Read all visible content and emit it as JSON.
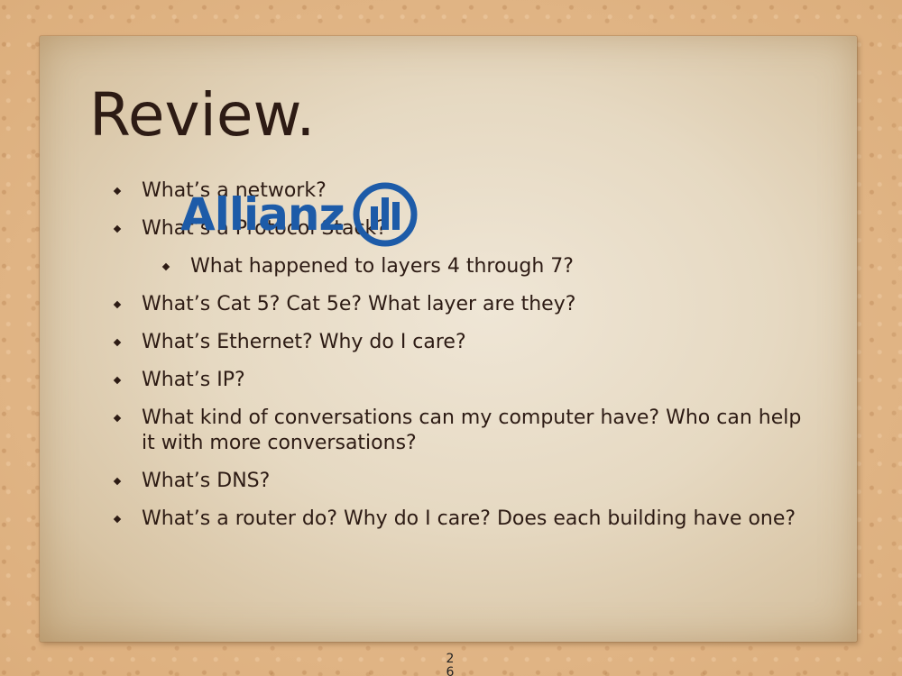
{
  "slide": {
    "title": "Review.",
    "page_number": "26"
  },
  "logo": {
    "text": "Allianz",
    "icon": "allianz-eagle-bars-icon",
    "color": "#1d5ba8"
  },
  "bullets": [
    {
      "text": "What’s a network?",
      "level": 1
    },
    {
      "text": "What’s a Protocol Stack?",
      "level": 1
    },
    {
      "text": "What happened to layers 4 through 7?",
      "level": 2
    },
    {
      "text": "What’s Cat 5? Cat 5e? What layer are they?",
      "level": 1
    },
    {
      "text": "What’s Ethernet? Why do I care?",
      "level": 1
    },
    {
      "text": "What’s IP?",
      "level": 1
    },
    {
      "text": "What kind of conversations can my computer have? Who can help it with more conversations?",
      "level": 1
    },
    {
      "text": "What’s DNS?",
      "level": 1
    },
    {
      "text": "What’s a router do? Why do I care? Does each building have one?",
      "level": 1
    }
  ],
  "colors": {
    "text": "#2d1b14",
    "background": "#e3b98a",
    "paper": "#e6d9c2"
  }
}
